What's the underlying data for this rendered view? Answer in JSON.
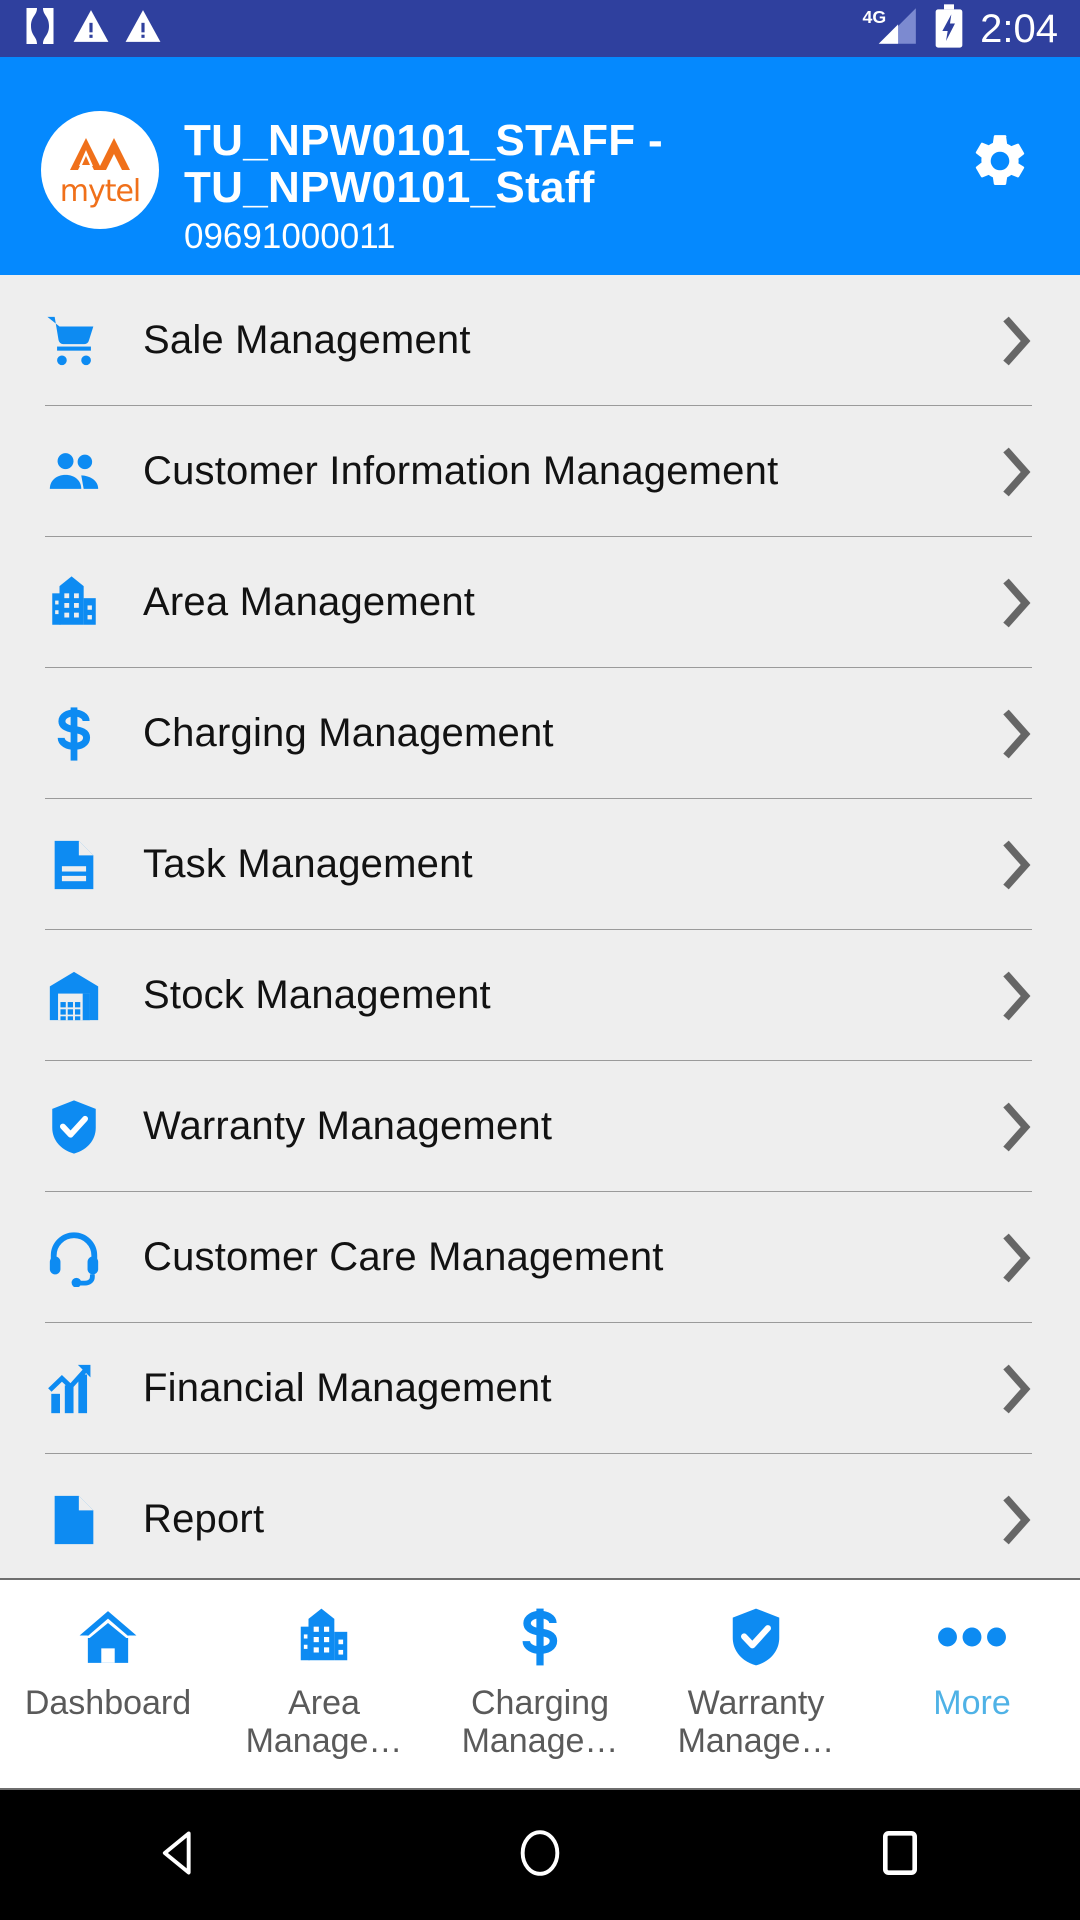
{
  "statusbar": {
    "time": "2:04",
    "network_label": "4G",
    "icons": [
      "app-notification-icon",
      "warning-icon",
      "warning-icon",
      "signal-4g-icon",
      "battery-charging-icon"
    ]
  },
  "header": {
    "logo_text": "mytel",
    "logo_icon": "mytel-mountain-logo",
    "title": "TU_NPW0101_STAFF -\nTU_NPW0101_Staff",
    "phone": "09691000011",
    "settings_icon": "gear-icon",
    "bg_color": "#0589fe"
  },
  "menu": {
    "items": [
      {
        "label": "Sale Management",
        "icon": "shopping-cart-icon"
      },
      {
        "label": "Customer Information Management",
        "icon": "people-icon"
      },
      {
        "label": "Area Management",
        "icon": "building-icon"
      },
      {
        "label": "Charging Management",
        "icon": "dollar-sign-icon"
      },
      {
        "label": "Task Management",
        "icon": "document-icon"
      },
      {
        "label": "Stock Management",
        "icon": "warehouse-icon"
      },
      {
        "label": "Warranty Management",
        "icon": "shield-check-icon"
      },
      {
        "label": "Customer Care Management",
        "icon": "headset-icon"
      },
      {
        "label": "Financial Management",
        "icon": "bar-chart-up-icon"
      },
      {
        "label": "Report",
        "icon": "document-icon"
      }
    ],
    "chevron_icon": "chevron-right-icon",
    "bg_color": "#eeeeee",
    "icon_color": "#0d8bf2"
  },
  "bottom_nav": {
    "tabs": [
      {
        "label": "Dashboard",
        "icon": "home-icon",
        "active": false
      },
      {
        "label": "Area\nManage…",
        "icon": "building-icon",
        "active": false
      },
      {
        "label": "Charging\nManage…",
        "icon": "dollar-sign-icon",
        "active": false
      },
      {
        "label": "Warranty\nManage…",
        "icon": "shield-check-icon",
        "active": false
      },
      {
        "label": "More",
        "icon": "more-dots-icon",
        "active": true
      }
    ],
    "active_color": "#4fb2e6"
  },
  "android_nav": {
    "back_icon": "back-triangle-icon",
    "home_icon": "home-circle-icon",
    "recents_icon": "recents-square-icon"
  }
}
